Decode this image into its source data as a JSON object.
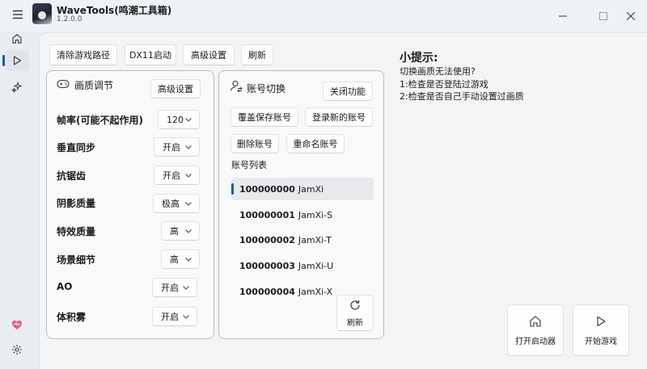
{
  "app": {
    "title": "WaveTools(鸣潮工具箱)",
    "version": "1.2.0.0"
  },
  "toolbar": {
    "clear_path": "清除游戏路径",
    "dx11": "DX11启动",
    "advanced": "高级设置",
    "refresh": "刷新"
  },
  "graphics": {
    "title": "画质调节",
    "advanced_btn": "高级设置",
    "rows": [
      {
        "label": "帧率(可能不起作用)",
        "value": "120"
      },
      {
        "label": "垂直同步",
        "value": "开启"
      },
      {
        "label": "抗锯齿",
        "value": "开启"
      },
      {
        "label": "阴影质量",
        "value": "极高"
      },
      {
        "label": "特效质量",
        "value": "高"
      },
      {
        "label": "场景细节",
        "value": "高"
      },
      {
        "label": "AO",
        "value": "开启"
      },
      {
        "label": "体积雾",
        "value": "开启"
      }
    ]
  },
  "account": {
    "title": "账号切换",
    "close_btn": "关闭功能",
    "overwrite_btn": "覆盖保存账号",
    "login_new_btn": "登录新的账号",
    "delete_btn": "删除账号",
    "rename_btn": "重命名账号",
    "list_title": "账号列表",
    "items": [
      {
        "id": "100000000",
        "name": "JamXi"
      },
      {
        "id": "100000001",
        "name": "JamXi-S"
      },
      {
        "id": "100000002",
        "name": "JamXi-T"
      },
      {
        "id": "100000003",
        "name": "JamXi-U"
      },
      {
        "id": "100000004",
        "name": "JamXi-X"
      }
    ],
    "refresh_label": "刷新"
  },
  "tips": {
    "title": "小提示:",
    "line1": "切换画质无法使用?",
    "line2": "1:检查是否登陆过游戏",
    "line3": "2:检查是否自己手动设置过画质"
  },
  "actions": {
    "open_launcher": "打开启动器",
    "start_game": "开始游戏"
  },
  "colors": {
    "accent": "#0a5ea8",
    "heart": "#e0607e"
  }
}
